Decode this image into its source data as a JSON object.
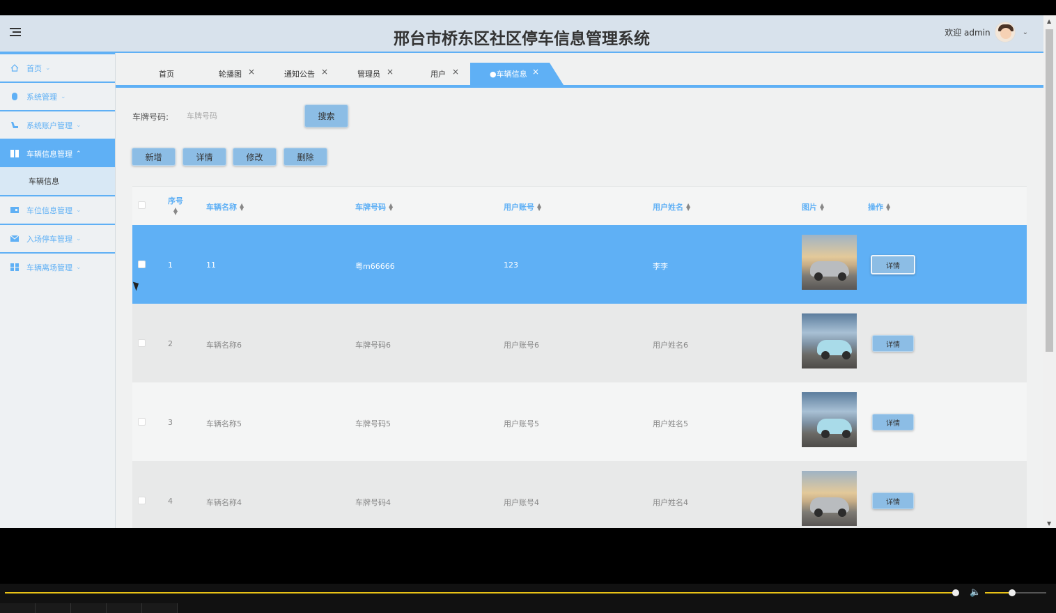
{
  "header": {
    "title": "邢台市桥东区社区停车信息管理系统",
    "welcome": "欢迎 admin"
  },
  "sidebar": {
    "items": [
      {
        "label": "首页",
        "icon": "home-icon"
      },
      {
        "label": "系统管理",
        "icon": "system-icon"
      },
      {
        "label": "系统账户管理",
        "icon": "account-icon"
      },
      {
        "label": "车辆信息管理",
        "icon": "car-info-icon",
        "active": true
      },
      {
        "label": "车位信息管理",
        "icon": "parking-space-icon"
      },
      {
        "label": "入场停车管理",
        "icon": "entry-parking-icon"
      },
      {
        "label": "车辆离场管理",
        "icon": "exit-icon"
      }
    ],
    "sub_item": "车辆信息"
  },
  "tabs": [
    {
      "label": "首页"
    },
    {
      "label": "轮播图"
    },
    {
      "label": "通知公告"
    },
    {
      "label": "管理员"
    },
    {
      "label": "用户"
    },
    {
      "label": "●车辆信息",
      "active": true
    }
  ],
  "search": {
    "label": "车牌号码:",
    "placeholder": "车牌号码",
    "button": "搜索"
  },
  "actions": {
    "add": "新增",
    "detail": "详情",
    "edit": "修改",
    "delete": "删除"
  },
  "table": {
    "columns": [
      "序号",
      "车辆名称",
      "车牌号码",
      "用户账号",
      "用户姓名",
      "图片",
      "操作"
    ],
    "rows": [
      {
        "index": "1",
        "name": "11",
        "plate": "粤m66666",
        "account": "123",
        "user": "李李",
        "image": "sunset",
        "action": "详情"
      },
      {
        "index": "2",
        "name": "车辆名称6",
        "plate": "车牌号码6",
        "account": "用户账号6",
        "user": "用户姓名6",
        "image": "sea",
        "action": "详情"
      },
      {
        "index": "3",
        "name": "车辆名称5",
        "plate": "车牌号码5",
        "account": "用户账号5",
        "user": "用户姓名5",
        "image": "sea",
        "action": "详情"
      },
      {
        "index": "4",
        "name": "车辆名称4",
        "plate": "车牌号码4",
        "account": "用户账号4",
        "user": "用户姓名4",
        "image": "sunset",
        "action": "详情"
      }
    ]
  },
  "colors": {
    "accent": "#5fb0f5",
    "button": "#8cbde5",
    "header_bg": "#d8e2ec"
  }
}
